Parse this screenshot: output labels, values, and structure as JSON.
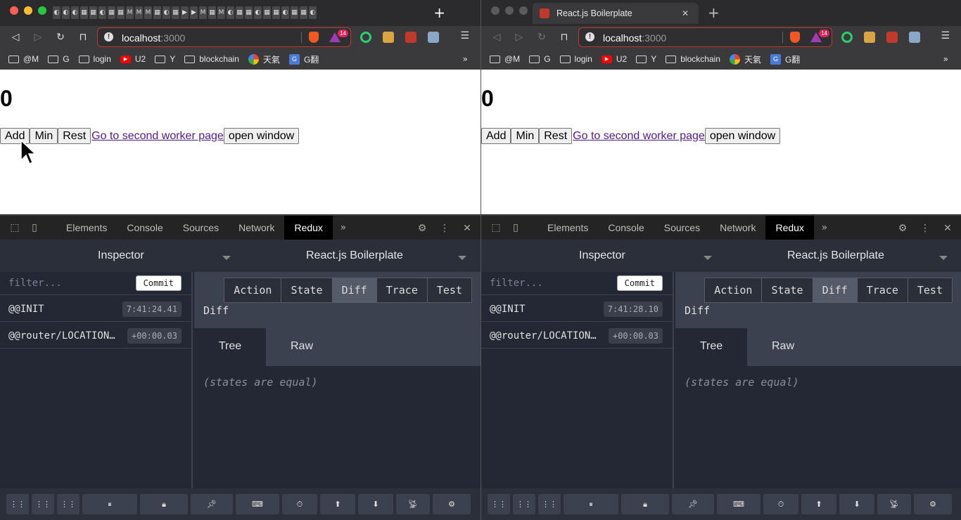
{
  "left": {
    "url_host": "localhost",
    "url_port": ":3000",
    "brave_badge": "14",
    "bookmarks": [
      "@M",
      "G",
      "login",
      "U2",
      "Y",
      "blockchain",
      "天氣",
      "G翻"
    ],
    "counter": "0",
    "buttons": {
      "add": "Add",
      "min": "Min",
      "rest": "Rest",
      "open": "open window"
    },
    "link": "Go to second worker page",
    "devtools_tabs": [
      "Elements",
      "Console",
      "Sources",
      "Network",
      "Redux"
    ],
    "inspector": "Inspector",
    "instance": "React.js Boilerplate",
    "filter_placeholder": "filter...",
    "commit": "Commit",
    "actions": [
      {
        "name": "@@INIT",
        "time": "7:41:24.41"
      },
      {
        "name": "@@router/LOCATION…",
        "time": "+00:00.03"
      }
    ],
    "monitor_tabs": [
      "Action",
      "State",
      "Diff",
      "Trace",
      "Test"
    ],
    "diff_label": "Diff",
    "view_tabs": [
      "Tree",
      "Raw"
    ],
    "equal_text": "(states are equal)"
  },
  "right": {
    "tab_title": "React.js Boilerplate",
    "url_host": "localhost",
    "url_port": ":3000",
    "brave_badge": "14",
    "bookmarks": [
      "@M",
      "G",
      "login",
      "U2",
      "Y",
      "blockchain",
      "天氣",
      "G翻"
    ],
    "counter": "0",
    "buttons": {
      "add": "Add",
      "min": "Min",
      "rest": "Rest",
      "open": "open window"
    },
    "link": "Go to second worker page",
    "devtools_tabs": [
      "Elements",
      "Console",
      "Sources",
      "Network",
      "Redux"
    ],
    "inspector": "Inspector",
    "instance": "React.js Boilerplate",
    "filter_placeholder": "filter...",
    "commit": "Commit",
    "actions": [
      {
        "name": "@@INIT",
        "time": "7:41:28.10"
      },
      {
        "name": "@@router/LOCATION…",
        "time": "+00:00.03"
      }
    ],
    "monitor_tabs": [
      "Action",
      "State",
      "Diff",
      "Trace",
      "Test"
    ],
    "diff_label": "Diff",
    "view_tabs": [
      "Tree",
      "Raw"
    ],
    "equal_text": "(states are equal)"
  },
  "colors": {
    "accent_red": "#c0392b",
    "link": "#551a8b",
    "redux_bg": "#232834"
  },
  "footer_icons": [
    "slider-left-icon",
    "slider-right-icon",
    "grid-icon",
    "pause-icon",
    "lock-icon",
    "pin-icon",
    "keyboard-icon",
    "timer-icon",
    "upload-icon",
    "download-icon",
    "remote-icon",
    "settings-icon"
  ]
}
